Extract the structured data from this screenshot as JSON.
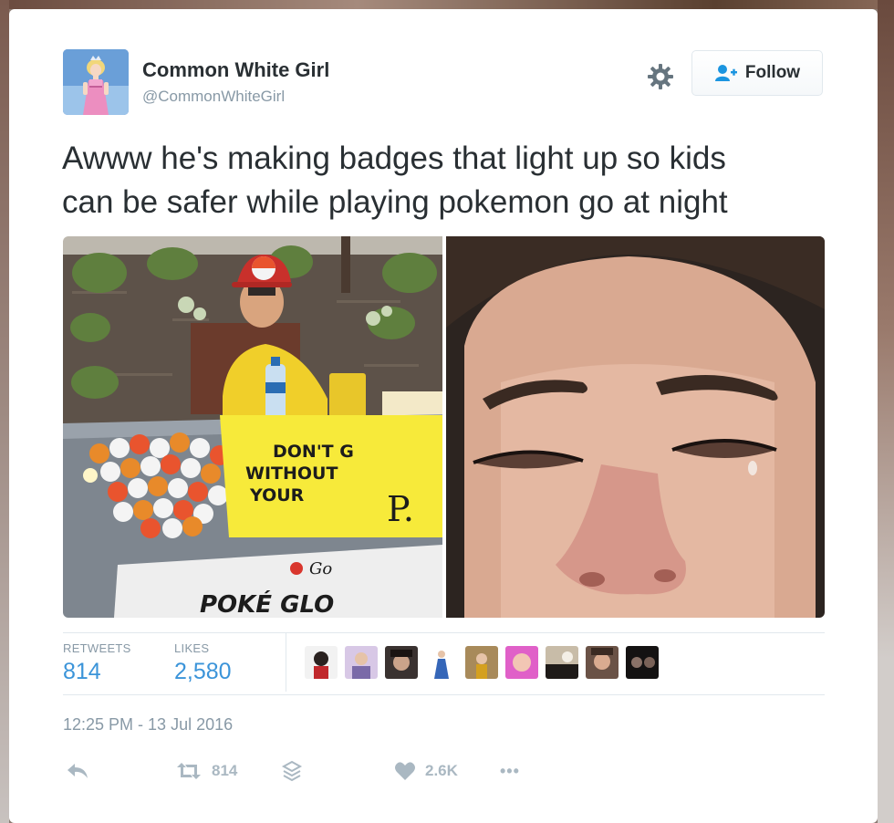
{
  "user": {
    "name": "Common White Girl",
    "handle": "@CommonWhiteGirl",
    "avatar_icon": "cinderella-avatar"
  },
  "header": {
    "follow_label": "Follow",
    "settings_icon": "gear-icon"
  },
  "tweet": {
    "text_line1": "Awww he's making badges that light up so kids",
    "text_line2": "can be safer while playing pokemon go at night"
  },
  "media": {
    "left_photo_sign_line1": "DON'T G",
    "left_photo_sign_line2": "WITHOUT",
    "left_photo_sign_line3": "YOUR",
    "left_photo_sign_p": "P.",
    "left_photo_banner_small": "Go",
    "left_photo_banner_big": "POKÉ GLO"
  },
  "stats": {
    "retweets_label": "RETWEETS",
    "retweets_value": "814",
    "likes_label": "LIKES",
    "likes_value": "2,580"
  },
  "timestamp": "12:25 PM - 13 Jul 2016",
  "actions": {
    "retweet_count": "814",
    "like_count": "2.6K",
    "more_label": "•••"
  },
  "colors": {
    "link_blue": "#3b94d9",
    "muted_gray": "#8899a6",
    "text_dark": "#292f33"
  }
}
